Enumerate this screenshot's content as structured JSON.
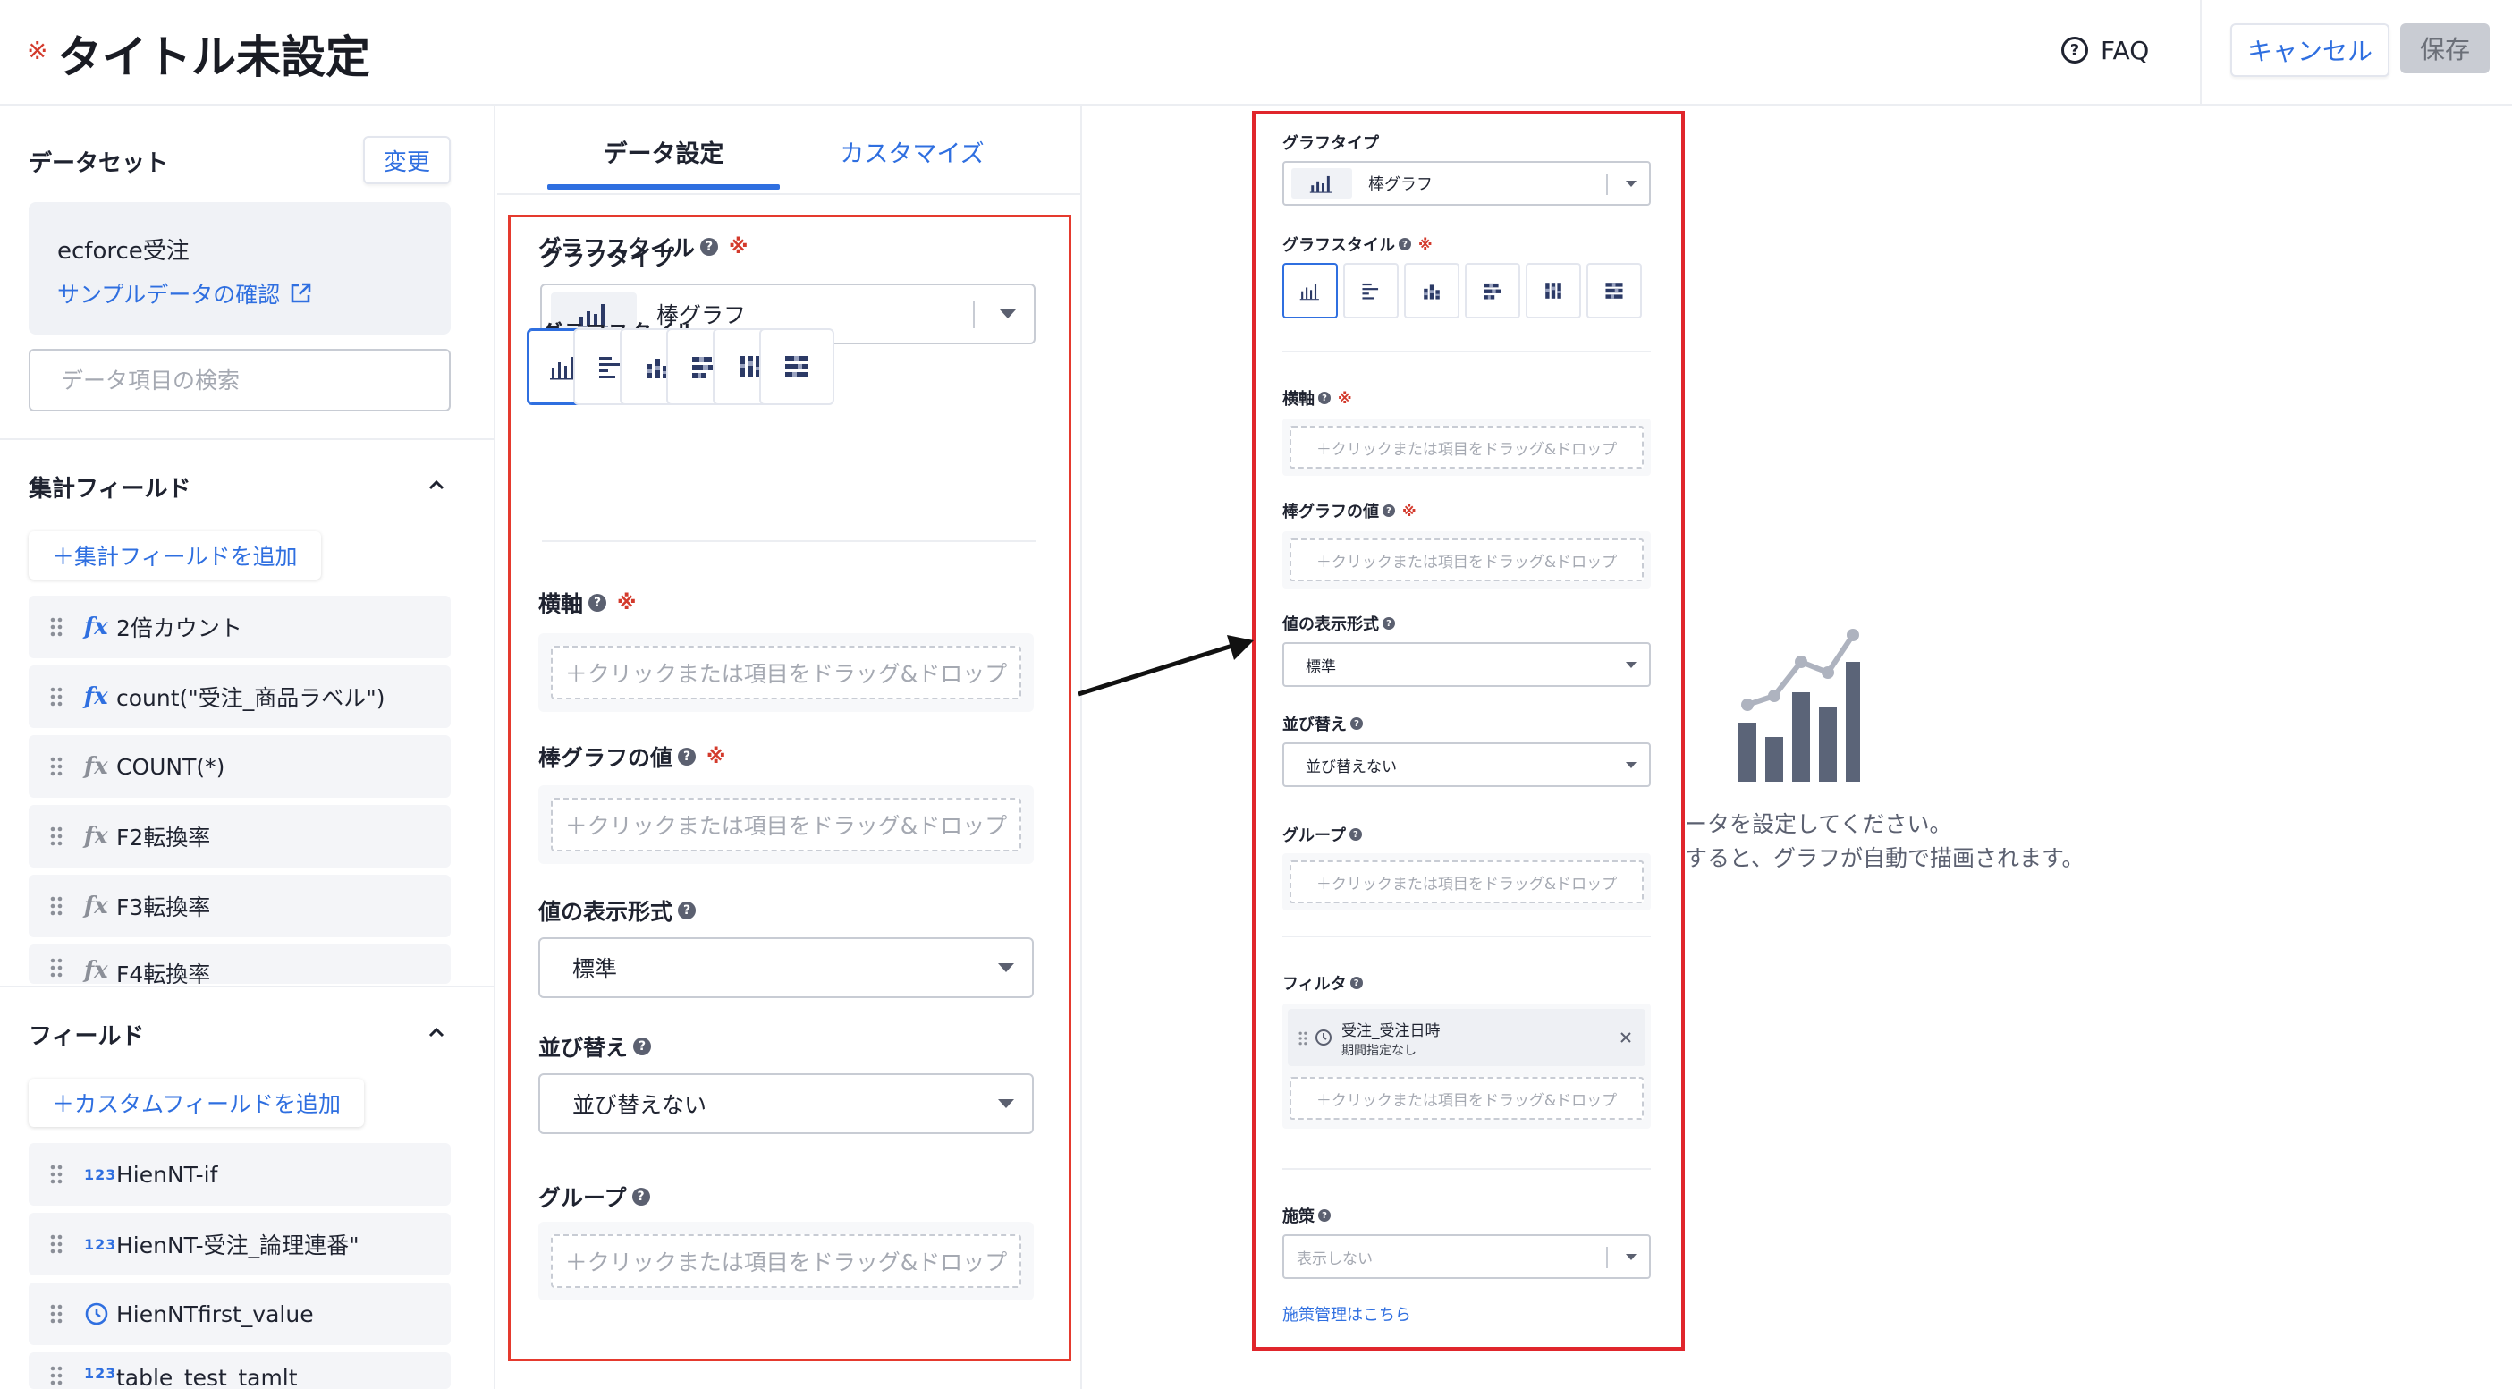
{
  "header": {
    "required_mark": "※",
    "title": "タイトル未設定",
    "faq_label": "FAQ",
    "cancel_label": "キャンセル",
    "save_label": "保存"
  },
  "sidebar": {
    "dataset_label": "データセット",
    "change_label": "変更",
    "dataset_name": "ecforce受注",
    "sample_link": "サンプルデータの確認",
    "search_placeholder": "データ項目の検索",
    "aggregate_section": {
      "title": "集計フィールド",
      "add_label": "＋集計フィールドを追加",
      "items": [
        {
          "label": "2倍カウント",
          "icon": "fx-icon-blue"
        },
        {
          "label": "count(\"受注_商品ラベル\")",
          "icon": "fx-icon-blue"
        },
        {
          "label": "COUNT(*)",
          "icon": "fx-icon-gray"
        },
        {
          "label": "F2転換率",
          "icon": "fx-icon-gray"
        },
        {
          "label": "F3転換率",
          "icon": "fx-icon-gray"
        },
        {
          "label": "F4転換率",
          "icon": "fx-icon-gray"
        }
      ]
    },
    "field_section": {
      "title": "フィールド",
      "add_label": "＋カスタムフィールドを追加",
      "items": [
        {
          "label": "HienNT-if",
          "icon": "number-icon"
        },
        {
          "label": "HienNT-受注_論理連番\"",
          "icon": "number-icon"
        },
        {
          "label": "HienNTfirst_value",
          "icon": "clock-icon"
        },
        {
          "label": "table_test_tamlt",
          "icon": "number-icon"
        }
      ]
    }
  },
  "settings": {
    "tabs": [
      "データ設定",
      "カスタマイズ"
    ],
    "active_tab": 0,
    "graph_type_label": "グラフタイプ",
    "graph_type_value": "棒グラフ",
    "graph_style_label": "グラフスタイル",
    "required_mark": "※",
    "x_axis_label": "横軸",
    "bar_value_label": "棒グラフの値",
    "value_format_label": "値の表示形式",
    "value_format_value": "標準",
    "sort_label": "並び替え",
    "sort_value": "並び替えない",
    "group_label": "グループ",
    "dropzone_text": "＋クリックまたは項目をドラッグ&ドロップ",
    "filter_label": "フィルタ",
    "filter_item_name": "受注_受注日時",
    "filter_item_sub": "期間指定なし",
    "measure_label": "施策",
    "measure_placeholder": "表示しない",
    "measure_link": "施策管理はこちら"
  },
  "preview": {
    "empty_line1": "ータを設定してください。",
    "empty_line2": "すると、グラフが自動で描画されます。"
  },
  "colors": {
    "accent": "#2f6fe0",
    "required": "#d33a2c",
    "annotation_red": "#e0262c",
    "chart_icon": "#5b6478"
  }
}
